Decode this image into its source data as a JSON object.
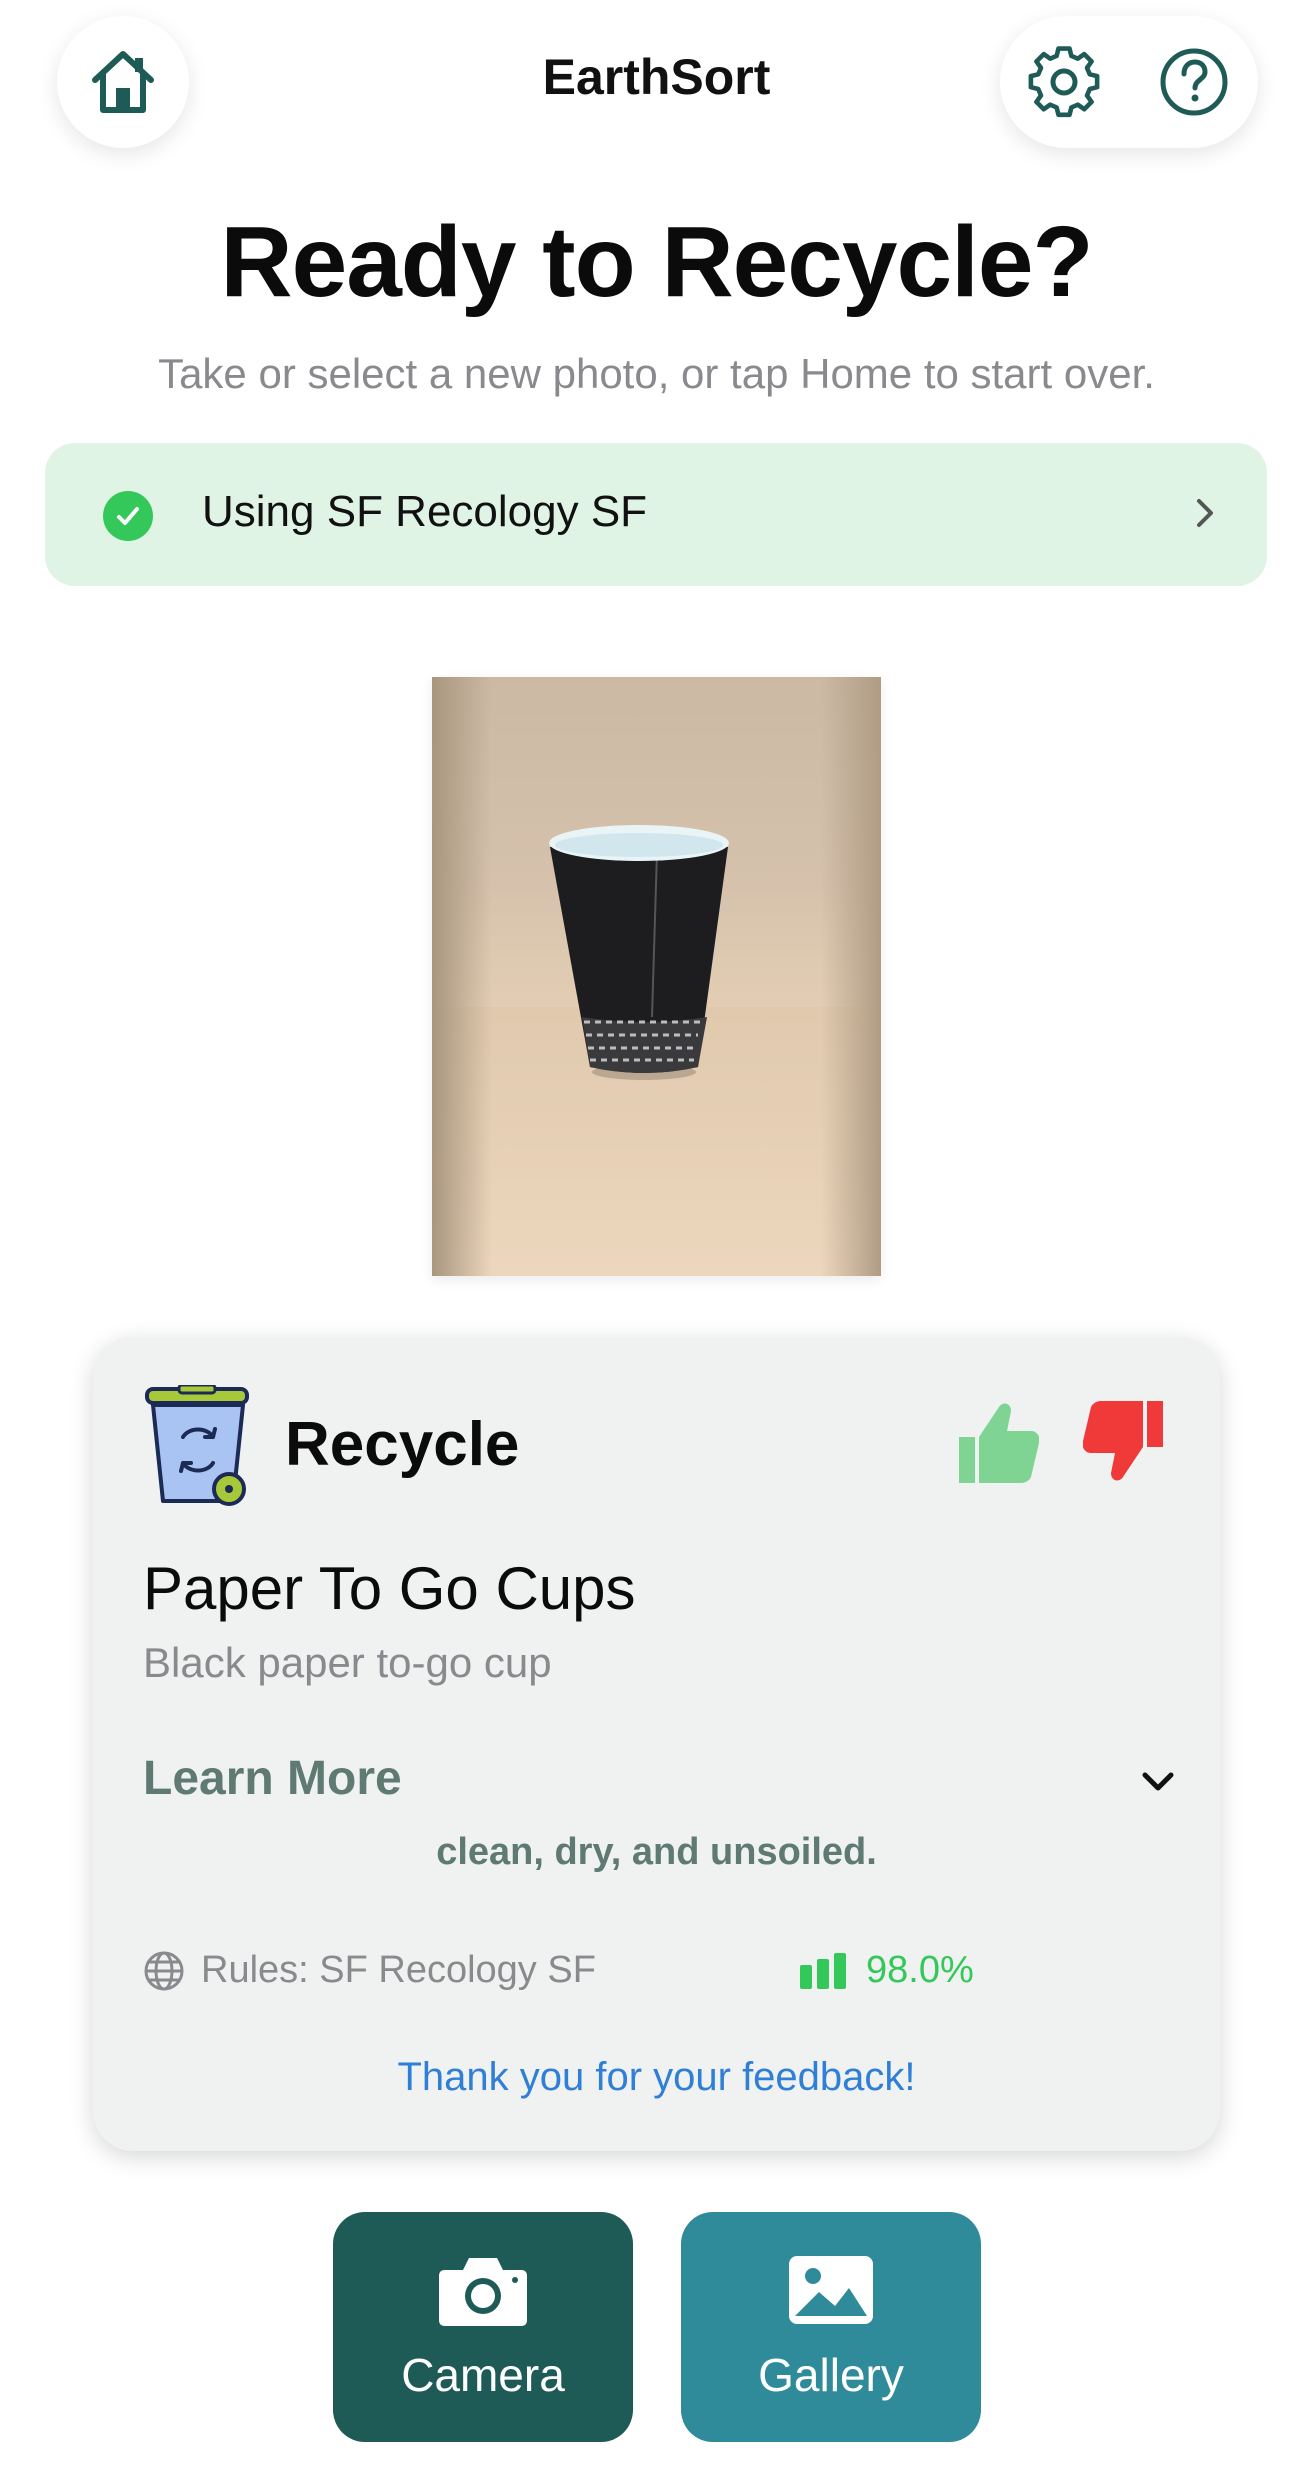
{
  "header": {
    "app_title": "EarthSort",
    "home_icon": "home-icon",
    "settings_icon": "gear-icon",
    "help_icon": "question-circle-icon"
  },
  "main": {
    "headline": "Ready to Recycle?",
    "subline": "Take or select a new photo, or tap Home to start over."
  },
  "rules_banner": {
    "text": "Using SF Recology SF",
    "status_icon": "check-circle-icon",
    "chevron_icon": "chevron-right-icon"
  },
  "photo": {
    "subject": "black paper to-go cup"
  },
  "result": {
    "category": "Recycle",
    "category_icon": "recycle-bin-icon",
    "item_name": "Paper To Go Cups",
    "item_description": "Black paper to-go cup",
    "learn_more_label": "Learn More",
    "learn_more_detail": "clean, dry, and unsoiled.",
    "rules_label": "Rules: SF Recology SF",
    "confidence": "98.0%",
    "feedback_message": "Thank you for your feedback!",
    "thumb_up_icon": "thumbs-up-icon",
    "thumb_down_icon": "thumbs-down-icon"
  },
  "actions": {
    "camera_label": "Camera",
    "gallery_label": "Gallery"
  },
  "colors": {
    "primary_dark": "#1e5b56",
    "primary_teal": "#2f8b9a",
    "success_green": "#34c759",
    "thumb_up_green": "#7fd494",
    "thumb_down_red": "#f03a3a",
    "feedback_blue": "#2f7fd6",
    "banner_bg": "#dff4e4",
    "card_bg": "#eff2f1"
  }
}
